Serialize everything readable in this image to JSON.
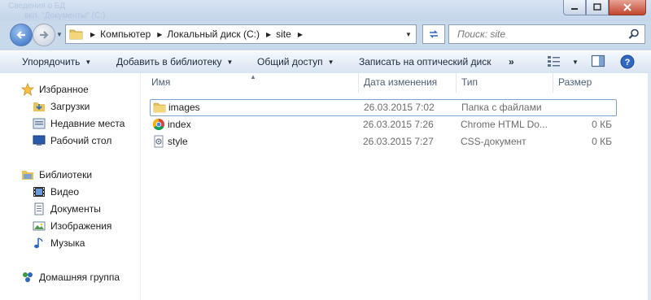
{
  "window": {
    "ghost_title_lines": [
      "Сведения о БД",
      "вкл. \"Документы\" (C:)"
    ]
  },
  "address": {
    "crumbs": [
      "Компьютер",
      "Локальный диск (C:)",
      "site"
    ]
  },
  "search": {
    "placeholder": "Поиск: site"
  },
  "toolbar": {
    "organize": "Упорядочить",
    "add_to_library": "Добавить в библиотеку",
    "share": "Общий доступ",
    "burn": "Записать на оптический диск",
    "more": "»"
  },
  "sidebar": {
    "favorites": {
      "label": "Избранное",
      "items": [
        {
          "label": "Загрузки",
          "icon": "downloads-folder-icon"
        },
        {
          "label": "Недавние места",
          "icon": "recent-places-icon"
        },
        {
          "label": "Рабочий стол",
          "icon": "desktop-icon"
        }
      ]
    },
    "libraries": {
      "label": "Библиотеки",
      "items": [
        {
          "label": "Видео",
          "icon": "video-icon"
        },
        {
          "label": "Документы",
          "icon": "documents-icon"
        },
        {
          "label": "Изображения",
          "icon": "pictures-icon"
        },
        {
          "label": "Музыка",
          "icon": "music-icon"
        }
      ]
    },
    "homegroup": {
      "label": "Домашняя группа"
    }
  },
  "columns": {
    "name": "Имя",
    "date": "Дата изменения",
    "type": "Тип",
    "size": "Размер"
  },
  "files": [
    {
      "name": "images",
      "date": "26.03.2015 7:02",
      "type": "Папка с файлами",
      "size": "",
      "icon": "folder-icon"
    },
    {
      "name": "index",
      "date": "26.03.2015 7:26",
      "type": "Chrome HTML Do...",
      "size": "0 КБ",
      "icon": "chrome-icon"
    },
    {
      "name": "style",
      "date": "26.03.2015 7:27",
      "type": "CSS-документ",
      "size": "0 КБ",
      "icon": "css-file-icon"
    }
  ],
  "colors": {
    "accent": "#2f68c0",
    "folder": "#e8c25a",
    "selection_border": "#7da2ce"
  }
}
